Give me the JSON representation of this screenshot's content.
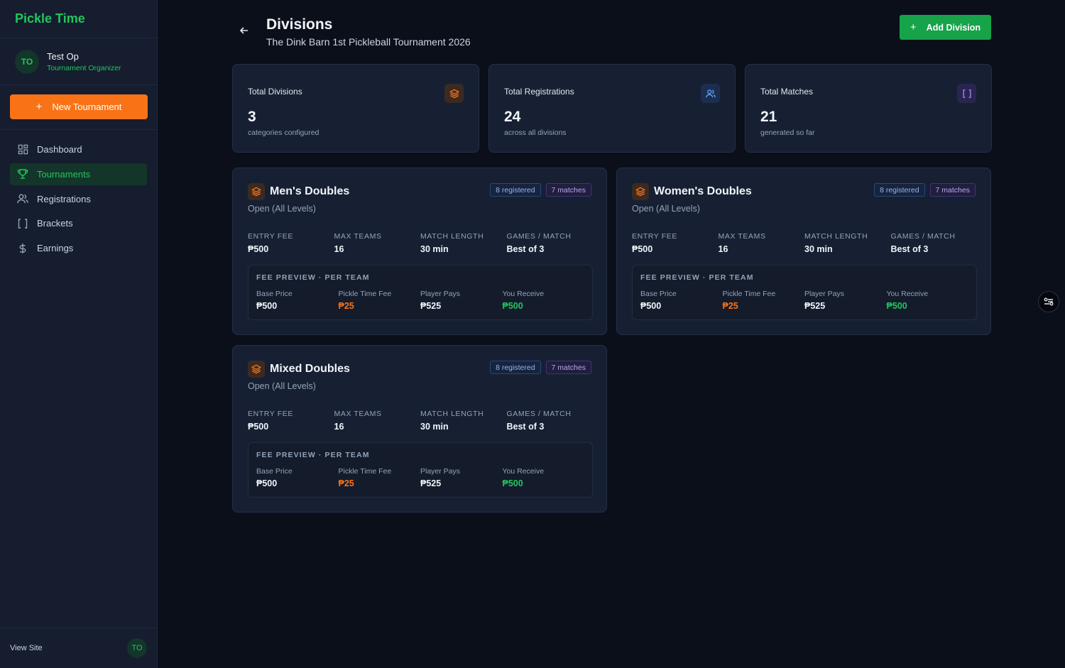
{
  "sidebar": {
    "brand": "Pickle Time",
    "user": {
      "initials": "TO",
      "name": "Test Op",
      "role": "Tournament Organizer"
    },
    "new_button": "New Tournament",
    "nav": [
      {
        "label": "Dashboard",
        "icon": "grid-icon",
        "active": false
      },
      {
        "label": "Tournaments",
        "icon": "trophy-icon",
        "active": true
      },
      {
        "label": "Registrations",
        "icon": "users-icon",
        "active": false
      },
      {
        "label": "Brackets",
        "icon": "brackets-icon",
        "active": false
      },
      {
        "label": "Earnings",
        "icon": "dollar-icon",
        "active": false
      }
    ],
    "footer": {
      "view_site": "View Site",
      "initials": "TO"
    }
  },
  "header": {
    "title": "Divisions",
    "subtitle": "The Dink Barn 1st Pickleball Tournament 2026",
    "add_button": "Add Division"
  },
  "stats": [
    {
      "label": "Total Divisions",
      "value": "3",
      "sub": "categories configured",
      "icon": "layers-icon",
      "color": "#f97316"
    },
    {
      "label": "Total Registrations",
      "value": "24",
      "sub": "across all divisions",
      "icon": "users-icon",
      "color": "#60a5fa"
    },
    {
      "label": "Total Matches",
      "value": "21",
      "sub": "generated so far",
      "icon": "brackets-icon",
      "color": "#a78bfa"
    }
  ],
  "divisions": [
    {
      "name": "Men's Doubles",
      "level": "Open (All Levels)",
      "registered": "8 registered",
      "matches": "7 matches",
      "specs": [
        {
          "label": "ENTRY FEE",
          "value": "₱500"
        },
        {
          "label": "MAX TEAMS",
          "value": "16"
        },
        {
          "label": "MATCH LENGTH",
          "value": "30 min"
        },
        {
          "label": "GAMES / MATCH",
          "value": "Best of 3"
        }
      ],
      "fee_title": "FEE PREVIEW · PER TEAM",
      "fees": [
        {
          "label": "Base Price",
          "value": "₱500"
        },
        {
          "label": "Pickle Time Fee",
          "value": "₱25"
        },
        {
          "label": "Player Pays",
          "value": "₱525"
        },
        {
          "label": "You Receive",
          "value": "₱500"
        }
      ]
    },
    {
      "name": "Women's Doubles",
      "level": "Open (All Levels)",
      "registered": "8 registered",
      "matches": "7 matches",
      "specs": [
        {
          "label": "ENTRY FEE",
          "value": "₱500"
        },
        {
          "label": "MAX TEAMS",
          "value": "16"
        },
        {
          "label": "MATCH LENGTH",
          "value": "30 min"
        },
        {
          "label": "GAMES / MATCH",
          "value": "Best of 3"
        }
      ],
      "fee_title": "FEE PREVIEW · PER TEAM",
      "fees": [
        {
          "label": "Base Price",
          "value": "₱500"
        },
        {
          "label": "Pickle Time Fee",
          "value": "₱25"
        },
        {
          "label": "Player Pays",
          "value": "₱525"
        },
        {
          "label": "You Receive",
          "value": "₱500"
        }
      ]
    },
    {
      "name": "Mixed Doubles",
      "level": "Open (All Levels)",
      "registered": "8 registered",
      "matches": "7 matches",
      "specs": [
        {
          "label": "ENTRY FEE",
          "value": "₱500"
        },
        {
          "label": "MAX TEAMS",
          "value": "16"
        },
        {
          "label": "MATCH LENGTH",
          "value": "30 min"
        },
        {
          "label": "GAMES / MATCH",
          "value": "Best of 3"
        }
      ],
      "fee_title": "FEE PREVIEW · PER TEAM",
      "fees": [
        {
          "label": "Base Price",
          "value": "₱500"
        },
        {
          "label": "Pickle Time Fee",
          "value": "₱25"
        },
        {
          "label": "Player Pays",
          "value": "₱525"
        },
        {
          "label": "You Receive",
          "value": "₱500"
        }
      ]
    }
  ],
  "colors": {
    "brand_green": "#22c55e",
    "accent_orange": "#f97316",
    "background": "#0b0f1a",
    "card": "#172033"
  }
}
